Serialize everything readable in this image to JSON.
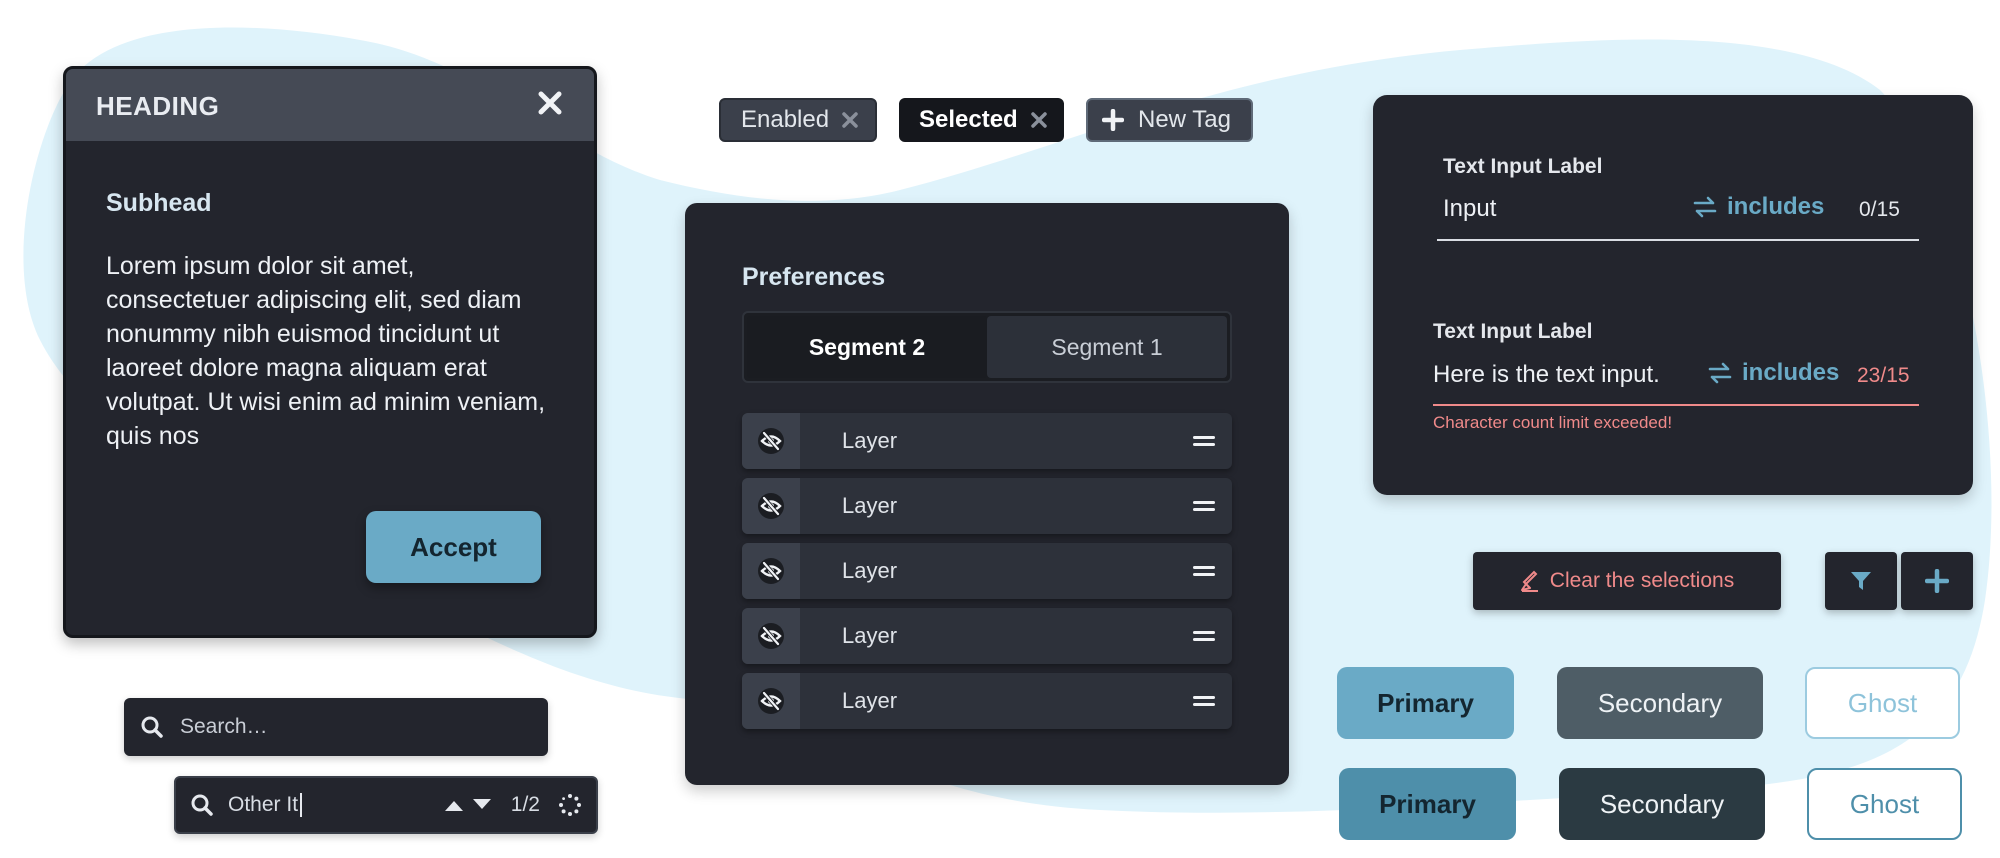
{
  "colors": {
    "accent": "#6aaac6",
    "panel": "#23252d",
    "background_blob": "#dff3fb",
    "error": "#f08a8a"
  },
  "dialog": {
    "title": "HEADING",
    "close_icon": "close-icon",
    "subhead": "Subhead",
    "body": "Lorem ipsum dolor sit amet, consectetuer adipiscing elit, sed diam nonummy nibh euismod tincidunt ut laoreet dolore magna aliquam erat volutpat. Ut wisi enim ad minim veniam, quis nos",
    "accept_label": "Accept"
  },
  "search": {
    "placeholder": "Search…",
    "find_value": "Other It",
    "find_count": "1/2"
  },
  "tags": [
    {
      "label": "Enabled",
      "state": "enabled"
    },
    {
      "label": "Selected",
      "state": "selected"
    },
    {
      "label": "New Tag",
      "state": "new"
    }
  ],
  "preferences": {
    "title": "Preferences",
    "segments": [
      "Segment 2",
      "Segment 1"
    ],
    "active_segment": "Segment 2",
    "layers": [
      "Layer",
      "Layer",
      "Layer",
      "Layer",
      "Layer"
    ]
  },
  "text_inputs": [
    {
      "label": "Text Input Label",
      "value": "Input",
      "mode": "includes",
      "count": "0/15",
      "error": ""
    },
    {
      "label": "Text Input Label",
      "value": "Here is the text input.",
      "mode": "includes",
      "count": "23/15",
      "error": "Character count limit exceeded!"
    }
  ],
  "actions": {
    "clear_label": "Clear the selections"
  },
  "buttons": {
    "primary": "Primary",
    "secondary": "Secondary",
    "ghost": "Ghost"
  }
}
